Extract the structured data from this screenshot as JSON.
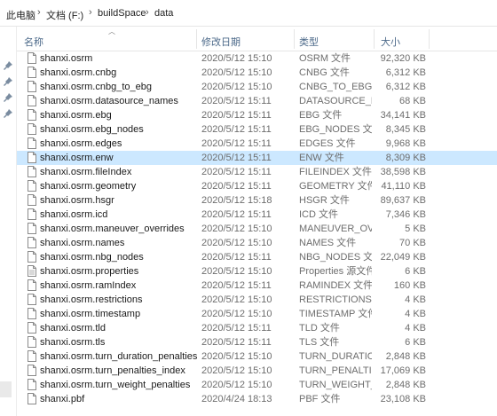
{
  "breadcrumb": {
    "items": [
      "此电脑",
      "文档 (F:)",
      "buildSpace",
      "data"
    ]
  },
  "columns": {
    "name": "名称",
    "date": "修改日期",
    "type": "类型",
    "size": "大小"
  },
  "files": [
    {
      "name": "shanxi.osrm",
      "date": "2020/5/12 15:10",
      "type": "OSRM 文件",
      "size": "92,320 KB"
    },
    {
      "name": "shanxi.osrm.cnbg",
      "date": "2020/5/12 15:10",
      "type": "CNBG 文件",
      "size": "6,312 KB"
    },
    {
      "name": "shanxi.osrm.cnbg_to_ebg",
      "date": "2020/5/12 15:10",
      "type": "CNBG_TO_EBG ...",
      "size": "6,312 KB"
    },
    {
      "name": "shanxi.osrm.datasource_names",
      "date": "2020/5/12 15:11",
      "type": "DATASOURCE_N...",
      "size": "68 KB"
    },
    {
      "name": "shanxi.osrm.ebg",
      "date": "2020/5/12 15:11",
      "type": "EBG 文件",
      "size": "34,141 KB"
    },
    {
      "name": "shanxi.osrm.ebg_nodes",
      "date": "2020/5/12 15:11",
      "type": "EBG_NODES 文件",
      "size": "8,345 KB"
    },
    {
      "name": "shanxi.osrm.edges",
      "date": "2020/5/12 15:11",
      "type": "EDGES 文件",
      "size": "9,968 KB"
    },
    {
      "name": "shanxi.osrm.enw",
      "date": "2020/5/12 15:11",
      "type": "ENW 文件",
      "size": "8,309 KB",
      "selected": true
    },
    {
      "name": "shanxi.osrm.fileIndex",
      "date": "2020/5/12 15:11",
      "type": "FILEINDEX 文件",
      "size": "38,598 KB"
    },
    {
      "name": "shanxi.osrm.geometry",
      "date": "2020/5/12 15:11",
      "type": "GEOMETRY 文件",
      "size": "41,110 KB"
    },
    {
      "name": "shanxi.osrm.hsgr",
      "date": "2020/5/12 15:18",
      "type": "HSGR 文件",
      "size": "89,637 KB"
    },
    {
      "name": "shanxi.osrm.icd",
      "date": "2020/5/12 15:11",
      "type": "ICD 文件",
      "size": "7,346 KB"
    },
    {
      "name": "shanxi.osrm.maneuver_overrides",
      "date": "2020/5/12 15:10",
      "type": "MANEUVER_OV...",
      "size": "5 KB"
    },
    {
      "name": "shanxi.osrm.names",
      "date": "2020/5/12 15:10",
      "type": "NAMES 文件",
      "size": "70 KB"
    },
    {
      "name": "shanxi.osrm.nbg_nodes",
      "date": "2020/5/12 15:11",
      "type": "NBG_NODES 文件",
      "size": "22,049 KB"
    },
    {
      "name": "shanxi.osrm.properties",
      "date": "2020/5/12 15:10",
      "type": "Properties 源文件",
      "size": "6 KB",
      "kind": "properties"
    },
    {
      "name": "shanxi.osrm.ramIndex",
      "date": "2020/5/12 15:11",
      "type": "RAMINDEX 文件",
      "size": "160 KB"
    },
    {
      "name": "shanxi.osrm.restrictions",
      "date": "2020/5/12 15:10",
      "type": "RESTRICTIONS ...",
      "size": "4 KB"
    },
    {
      "name": "shanxi.osrm.timestamp",
      "date": "2020/5/12 15:10",
      "type": "TIMESTAMP 文件",
      "size": "4 KB"
    },
    {
      "name": "shanxi.osrm.tld",
      "date": "2020/5/12 15:11",
      "type": "TLD 文件",
      "size": "4 KB"
    },
    {
      "name": "shanxi.osrm.tls",
      "date": "2020/5/12 15:11",
      "type": "TLS 文件",
      "size": "6 KB"
    },
    {
      "name": "shanxi.osrm.turn_duration_penalties",
      "date": "2020/5/12 15:10",
      "type": "TURN_DURATIO...",
      "size": "2,848 KB"
    },
    {
      "name": "shanxi.osrm.turn_penalties_index",
      "date": "2020/5/12 15:10",
      "type": "TURN_PENALTIE...",
      "size": "17,069 KB"
    },
    {
      "name": "shanxi.osrm.turn_weight_penalties",
      "date": "2020/5/12 15:10",
      "type": "TURN_WEIGHT_...",
      "size": "2,848 KB"
    },
    {
      "name": "shanxi.pbf",
      "date": "2020/4/24 18:13",
      "type": "PBF 文件",
      "size": "23,108 KB"
    }
  ],
  "colors": {
    "selected_row": "#cce8ff",
    "header_text": "#4d6a8a",
    "meta_text": "#6d6d6d"
  },
  "icons": {
    "file": "file-icon",
    "properties": "properties-file-icon",
    "pin": "pin-icon"
  }
}
